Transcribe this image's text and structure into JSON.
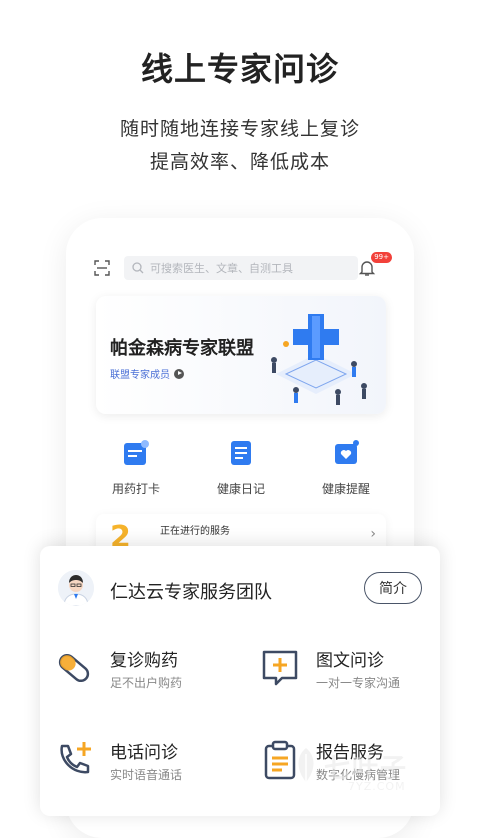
{
  "headline": {
    "title": "线上专家问诊",
    "subtitle_line1": "随时随地连接专家线上复诊",
    "subtitle_line2": "提高效率、降低成本"
  },
  "phone": {
    "search_placeholder": "可搜索医生、文章、自测工具",
    "notification_badge": "99+",
    "banner": {
      "title": "帕金森病专家联盟",
      "link": "联盟专家成员"
    },
    "quick_actions": [
      {
        "label": "用药打卡",
        "icon": "medicine-checkin-icon"
      },
      {
        "label": "健康日记",
        "icon": "health-diary-icon"
      },
      {
        "label": "健康提醒",
        "icon": "health-reminder-icon"
      }
    ],
    "service": {
      "count": "2",
      "title": "正在进行的服务"
    }
  },
  "team_card": {
    "name": "仁达云专家服务团队",
    "intro_button": "简介",
    "items": [
      {
        "title": "复诊购药",
        "desc": "足不出户购药",
        "icon": "pill-icon"
      },
      {
        "title": "图文问诊",
        "desc": "一对一专家沟通",
        "icon": "chat-plus-icon"
      },
      {
        "title": "电话问诊",
        "desc": "实时语音通话",
        "icon": "phone-plus-icon"
      },
      {
        "title": "报告服务",
        "desc": "数字化慢病管理",
        "icon": "clipboard-icon"
      }
    ]
  },
  "watermark": {
    "text": "七叶子",
    "sub": "7YZ.COM"
  },
  "colors": {
    "accent_blue": "#2f7bf0",
    "accent_orange": "#f6a623",
    "icon_dark": "#3d4a63"
  }
}
